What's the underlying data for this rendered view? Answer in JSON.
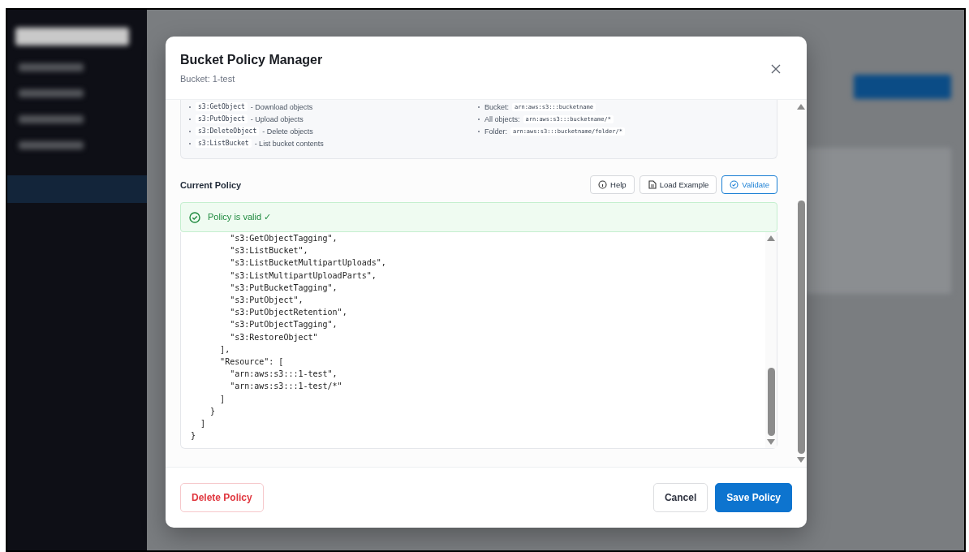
{
  "modal": {
    "title": "Bucket Policy Manager",
    "subtitle": "Bucket: 1-test"
  },
  "help": {
    "actions": [
      {
        "code": "s3:GetObject",
        "description": "- Download objects"
      },
      {
        "code": "s3:PutObject",
        "description": "- Upload objects"
      },
      {
        "code": "s3:DeleteObject",
        "description": "- Delete objects"
      },
      {
        "code": "s3:ListBucket",
        "description": "- List bucket contents"
      }
    ],
    "resources": [
      {
        "label": "Bucket:",
        "code": "arn:aws:s3:::bucketname"
      },
      {
        "label": "All objects:",
        "code": "arn:aws:s3:::bucketname/*"
      },
      {
        "label": "Folder:",
        "code": "arn:aws:s3:::bucketname/folder/*"
      }
    ]
  },
  "policy": {
    "heading": "Current Policy",
    "buttons": [
      {
        "label": "Help",
        "kind": "info"
      },
      {
        "label": "Load Example",
        "kind": "file"
      },
      {
        "label": "Validate",
        "kind": "validate"
      }
    ],
    "validation": {
      "valid": true,
      "message": "Policy is valid ✓"
    },
    "editor_lines": [
      "        \"s3:GetObjectTagging\",",
      "        \"s3:ListBucket\",",
      "        \"s3:ListBucketMultipartUploads\",",
      "        \"s3:ListMultipartUploadParts\",",
      "        \"s3:PutBucketTagging\",",
      "        \"s3:PutObject\",",
      "        \"s3:PutObjectRetention\",",
      "        \"s3:PutObjectTagging\",",
      "        \"s3:RestoreObject\"",
      "      ],",
      "      \"Resource\": [",
      "        \"arn:aws:s3:::1-test\",",
      "        \"arn:aws:s3:::1-test/*\"",
      "      ]",
      "    }",
      "  ]",
      "}"
    ]
  },
  "footer": {
    "delete_label": "Delete Policy",
    "cancel_label": "Cancel",
    "save_label": "Save Policy"
  }
}
